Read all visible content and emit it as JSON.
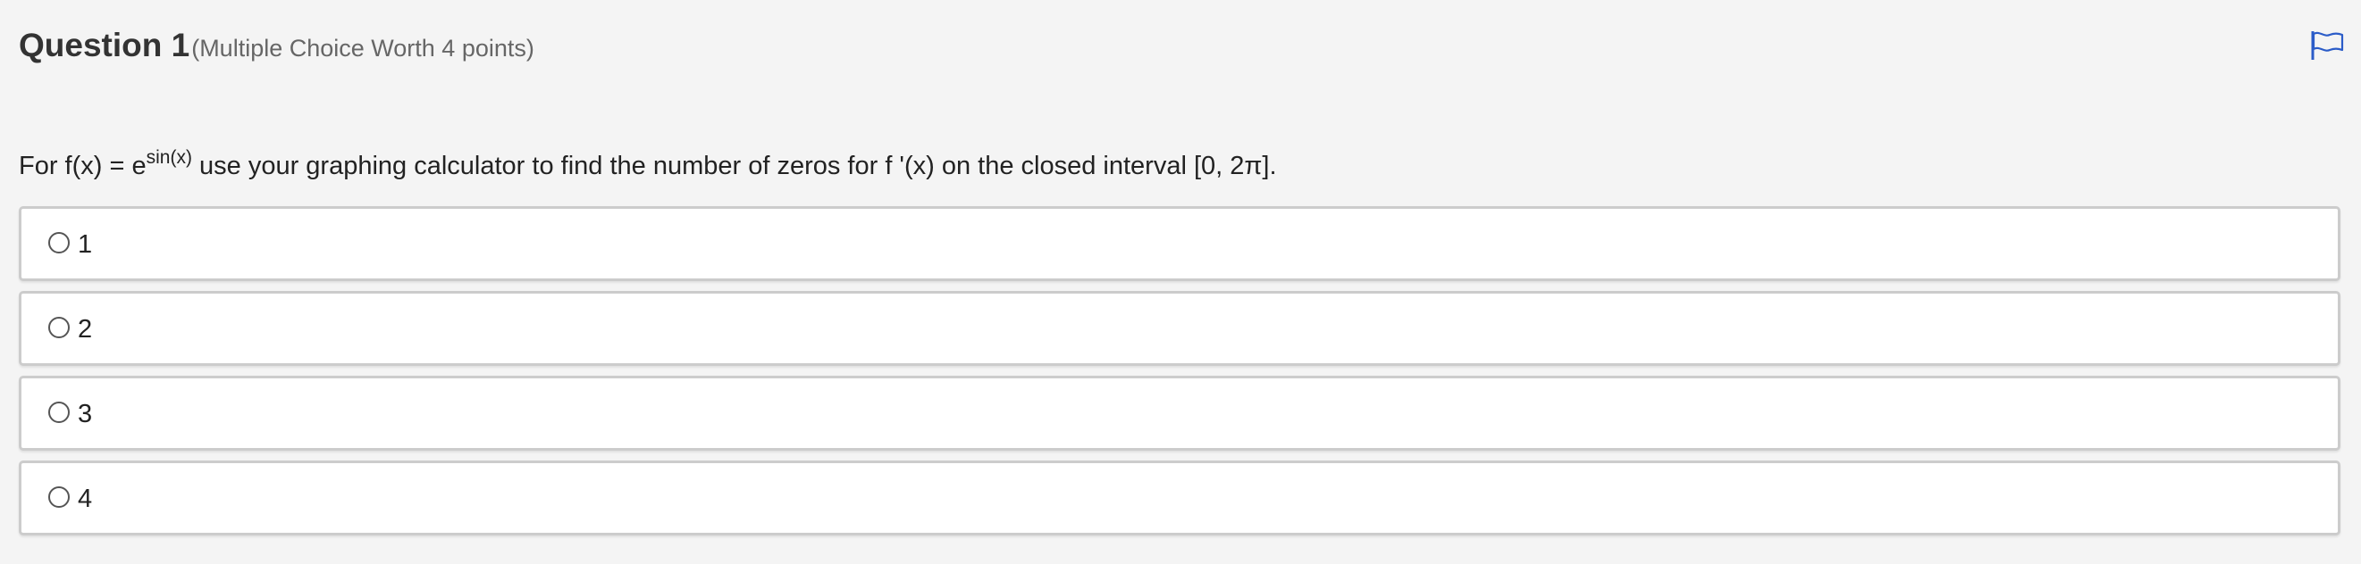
{
  "header": {
    "title": "Question 1",
    "meta": "(Multiple Choice Worth 4 points)",
    "flag_icon": "flag-icon",
    "flag_color": "#2b5cc8"
  },
  "question": {
    "prefix": "For f(x) = e",
    "exponent": "sin(x)",
    "suffix": " use your graphing calculator to find the number of zeros for f '(x) on the closed interval [0, 2π]."
  },
  "choices": [
    {
      "label": "1"
    },
    {
      "label": "2"
    },
    {
      "label": "3"
    },
    {
      "label": "4"
    }
  ]
}
